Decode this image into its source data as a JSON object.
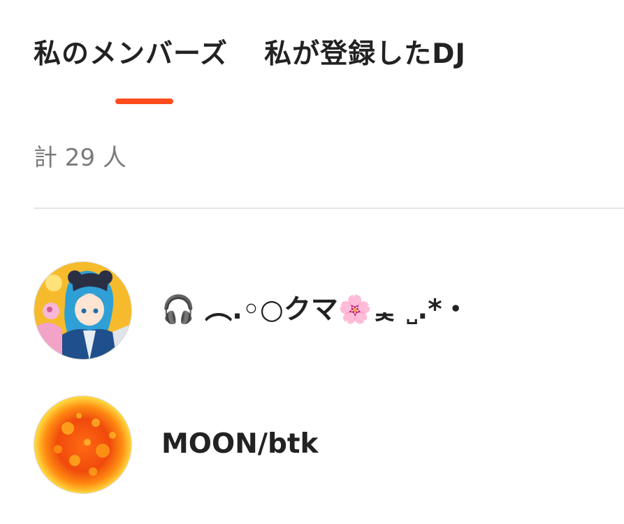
{
  "tabs": [
    {
      "label": "私のメンバーズ",
      "active": true
    },
    {
      "label": "私が登録したDJ",
      "active": false
    }
  ],
  "accent_color": "#ff4c1d",
  "member_count": "計 29 人",
  "members": [
    {
      "name": "🎧 ︵.◦○クマ🌸ᆾ ˽.*・",
      "avatar_icon": "anime-character-avatar"
    },
    {
      "name": "MOON/btk",
      "avatar_icon": "sun-avatar"
    }
  ]
}
